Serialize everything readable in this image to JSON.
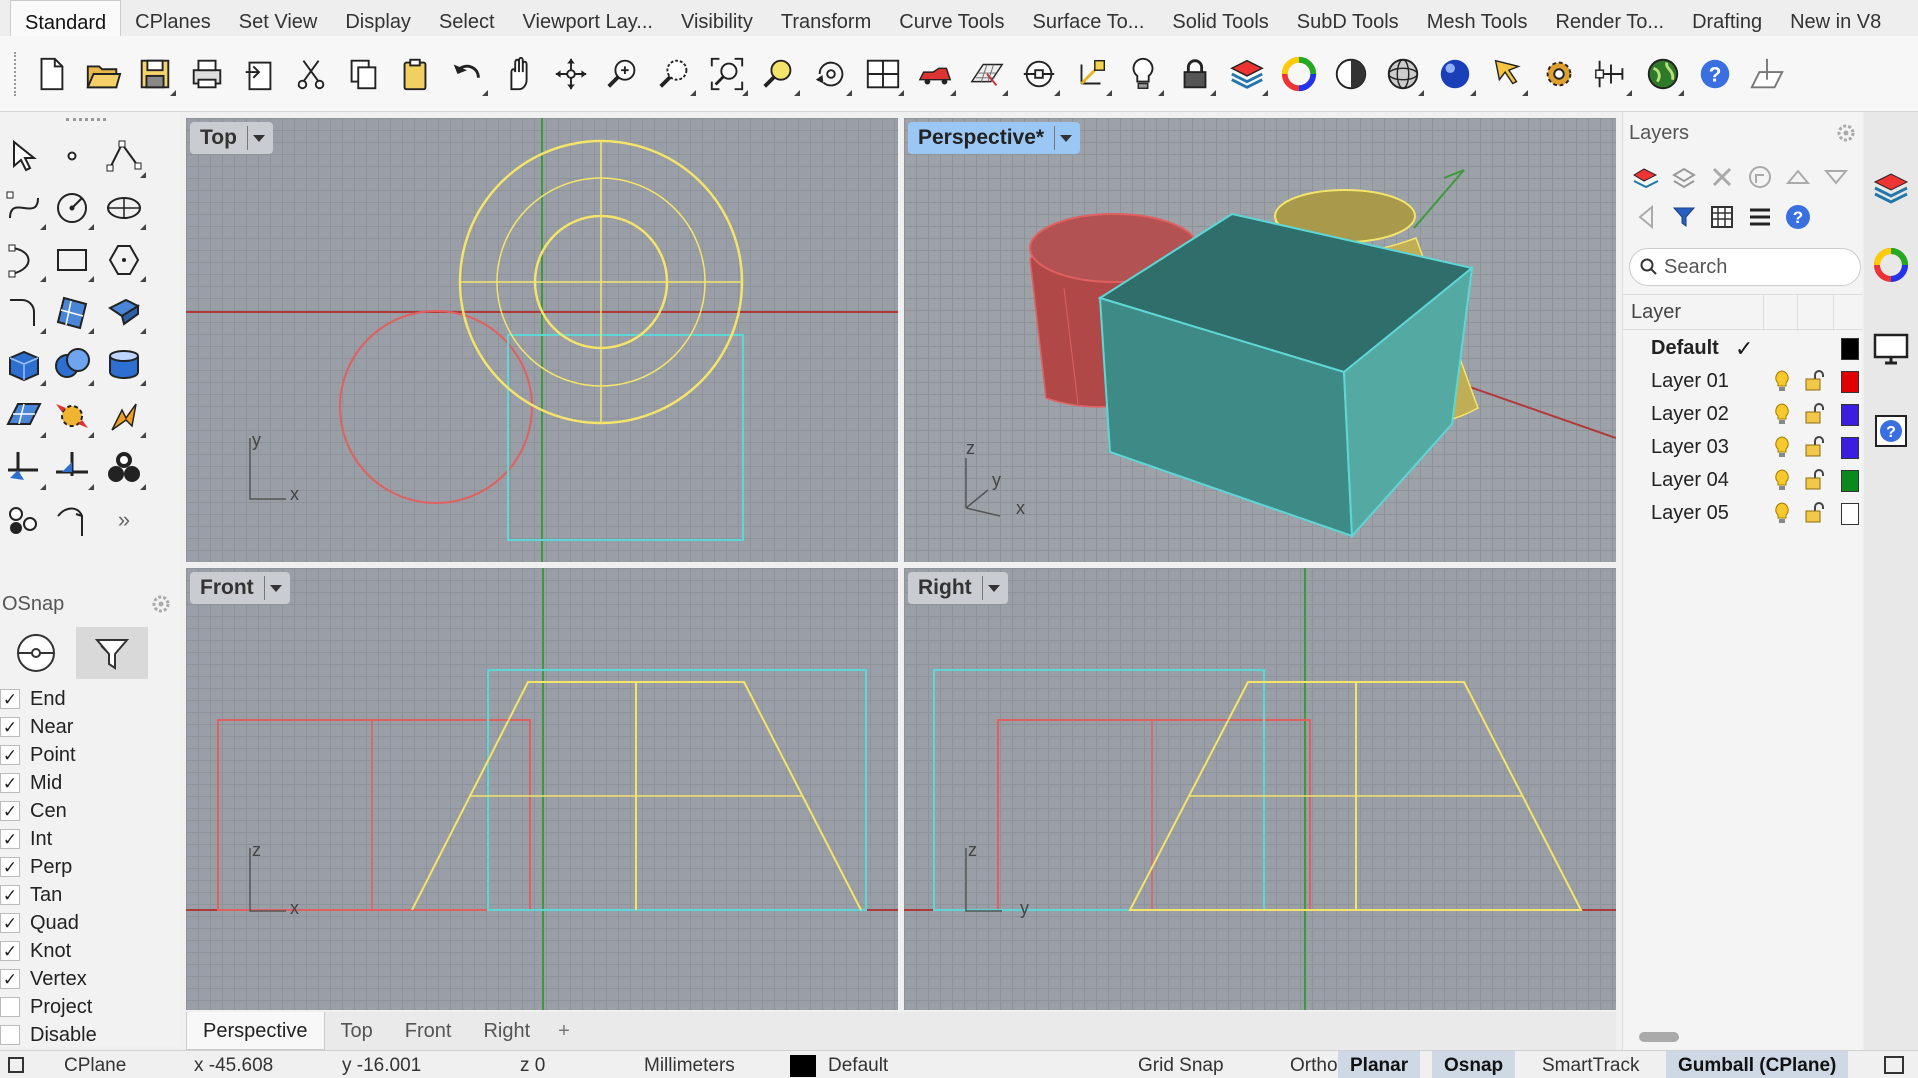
{
  "tabs": {
    "items": [
      "Standard",
      "CPlanes",
      "Set View",
      "Display",
      "Select",
      "Viewport Lay...",
      "Visibility",
      "Transform",
      "Curve Tools",
      "Surface To...",
      "Solid Tools",
      "SubD Tools",
      "Mesh Tools",
      "Render To...",
      "Drafting",
      "New in V8"
    ],
    "active": "Standard"
  },
  "toolbar_icons": [
    "new-file-icon",
    "open-folder-icon",
    "save-icon",
    "print-icon",
    "import-icon",
    "cut-icon",
    "copy-icon",
    "paste-icon",
    "undo-icon",
    "pan-hand-icon",
    "rotate-view-icon",
    "zoom-icon",
    "zoom-window-icon",
    "zoom-extents-icon",
    "zoom-selected-icon",
    "rotate-camera-icon",
    "four-viewports-icon",
    "car-icon",
    "grid-plane-icon",
    "osnap-icon",
    "gumball-icon",
    "light-bulb-icon",
    "lock-icon",
    "layer-icon",
    "color-wheel-icon",
    "shade-sphere-icon",
    "wire-sphere-icon",
    "render-sphere-icon",
    "pick-arrow-icon",
    "gear-options-icon",
    "dimension-icon",
    "globe-icon",
    "help-icon",
    "cplane-icon"
  ],
  "left_tools": [
    "select-arrow-icon",
    "point-icon",
    "polyline-icon",
    "curve-icon",
    "circle-icon",
    "ellipse-icon",
    "arc-icon",
    "rectangle-icon",
    "polygon-icon",
    "fillet-icon",
    "surface-icon",
    "loft-icon",
    "box-solid-icon",
    "boolean-icon",
    "cylinder-icon",
    "plane-icon",
    "transform-icon",
    "explode-icon",
    "dimension-tool-icon",
    "split-icon",
    "group-icon",
    "points-cloud-icon",
    "curve-edit-icon",
    "more-icon"
  ],
  "osnap": {
    "title": "OSnap",
    "items": [
      {
        "label": "End",
        "checked": true
      },
      {
        "label": "Near",
        "checked": true
      },
      {
        "label": "Point",
        "checked": true
      },
      {
        "label": "Mid",
        "checked": true
      },
      {
        "label": "Cen",
        "checked": true
      },
      {
        "label": "Int",
        "checked": true
      },
      {
        "label": "Perp",
        "checked": true
      },
      {
        "label": "Tan",
        "checked": true
      },
      {
        "label": "Quad",
        "checked": true
      },
      {
        "label": "Knot",
        "checked": true
      },
      {
        "label": "Vertex",
        "checked": true
      },
      {
        "label": "Project",
        "checked": false
      },
      {
        "label": "Disable",
        "checked": false
      }
    ]
  },
  "viewports": {
    "top": {
      "label": "Top",
      "axis_x": "x",
      "axis_y": "y"
    },
    "perspective": {
      "label": "Perspective*",
      "axis_x": "x",
      "axis_y": "y",
      "axis_z": "z"
    },
    "front": {
      "label": "Front",
      "axis_x": "x",
      "axis_y": "z"
    },
    "right": {
      "label": "Right",
      "axis_x": "y",
      "axis_y": "z"
    }
  },
  "viewport_tabs": {
    "items": [
      "Perspective",
      "Top",
      "Front",
      "Right"
    ],
    "active": "Perspective",
    "add_symbol": "+"
  },
  "layers": {
    "title": "Layers",
    "search_placeholder": "Search",
    "column_header": "Layer",
    "rows": [
      {
        "name": "Default",
        "current": true,
        "check_mark": "✓",
        "color": "#000000"
      },
      {
        "name": "Layer 01",
        "current": false,
        "color": "#e00000"
      },
      {
        "name": "Layer 02",
        "current": false,
        "color": "#3a1fe0"
      },
      {
        "name": "Layer 03",
        "current": false,
        "color": "#3a1fe0"
      },
      {
        "name": "Layer 04",
        "current": false,
        "color": "#0a8a1e"
      },
      {
        "name": "Layer 05",
        "current": false,
        "color": "#ffffff"
      }
    ]
  },
  "colors": {
    "curve_yellow": "#f4e56a",
    "curve_red": "#e06060",
    "curve_cyan": "#5fd6d6",
    "axis_red": "#b03a3a",
    "axis_green": "#3c9a3c",
    "box_teal": "#3e8a86",
    "accent_blue": "#9bc7f5"
  },
  "status": {
    "cplane": "CPlane",
    "x": "x -45.608",
    "y": "y -16.001",
    "z": "z 0",
    "units": "Millimeters",
    "layer": "Default",
    "panes": [
      {
        "label": "Grid Snap",
        "on": false
      },
      {
        "label": "Ortho",
        "on": false
      },
      {
        "label": "Planar",
        "on": true
      },
      {
        "label": "Osnap",
        "on": true
      },
      {
        "label": "SmartTrack",
        "on": false
      },
      {
        "label": "Gumball (CPlane)",
        "on": true
      }
    ]
  }
}
